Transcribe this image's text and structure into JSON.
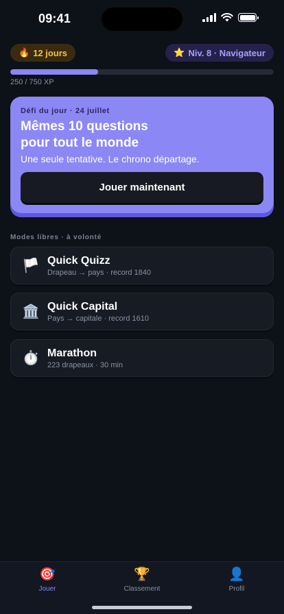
{
  "status_bar": {
    "time": "09:41",
    "icons": [
      "signal-icon",
      "wifi-icon",
      "battery-icon"
    ]
  },
  "streak": {
    "icon": "fire-icon",
    "emoji": "🔥",
    "label": "12 jours"
  },
  "level": {
    "icon": "star-icon",
    "emoji": "⭐",
    "label": "Niv. 8 · Navigateur"
  },
  "xp": {
    "label": "250 / 750 XP",
    "progress": 0.333
  },
  "daily": {
    "eyebrow": "Défi du jour · 24 juillet",
    "title_line1": "Mêmes 10 questions",
    "title_line2": "pour tout le monde",
    "subtitle": "Une seule tentative. Le chrono départage.",
    "button": "Jouer maintenant"
  },
  "section_title": "Modes libres · à volonté",
  "modes": [
    {
      "icon": "white-flag-icon",
      "emoji": "🏳️",
      "title": "Quick Quizz",
      "subtitle": "Drapeau → pays · record 1840"
    },
    {
      "icon": "classical-building-icon",
      "emoji": "🏛️",
      "title": "Quick Capital",
      "subtitle": "Pays → capitale · record 1610"
    },
    {
      "icon": "stopwatch-icon",
      "emoji": "⏱️",
      "title": "Marathon",
      "subtitle": "223 drapeaux · 30 min"
    }
  ],
  "tabs": [
    {
      "icon": "target-icon",
      "emoji": "🎯",
      "label": "Jouer",
      "active": true
    },
    {
      "icon": "trophy-icon",
      "emoji": "🏆",
      "label": "Classement",
      "active": false
    },
    {
      "icon": "profile-icon",
      "emoji": "👤",
      "label": "Profil",
      "active": false
    }
  ],
  "colors": {
    "background": "#0d1118",
    "accent": "#8a87f4",
    "streak": "#f5c04a",
    "card": "#161b24"
  }
}
